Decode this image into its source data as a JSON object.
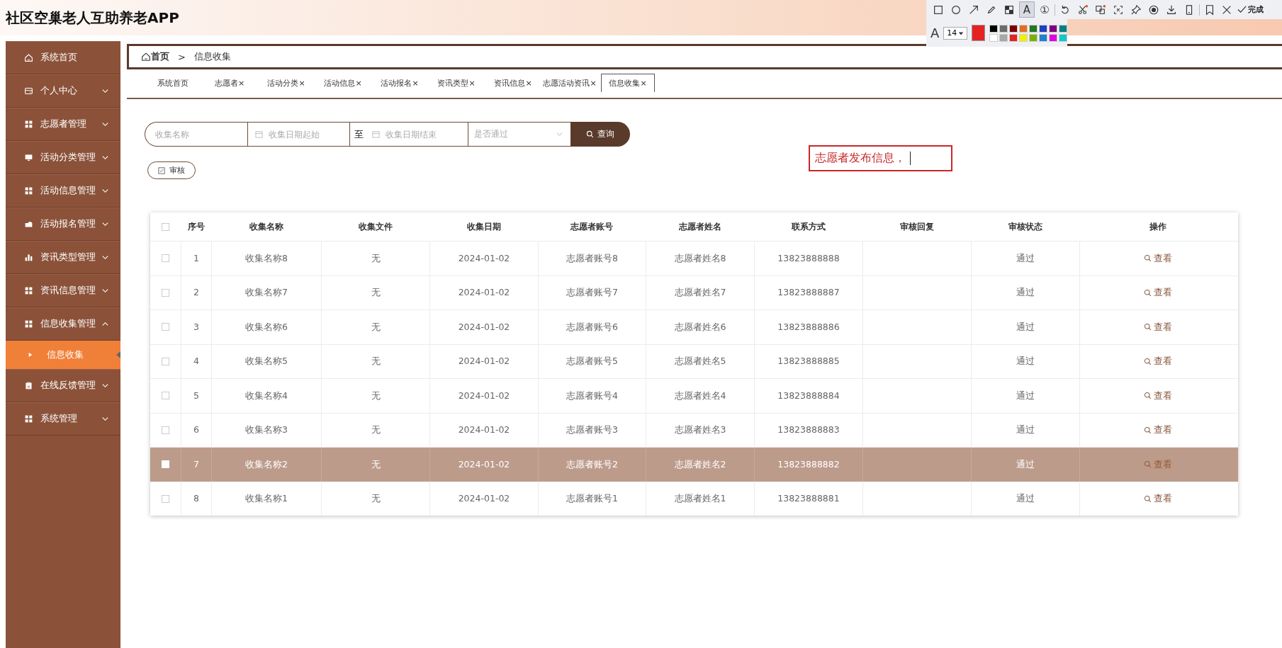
{
  "app_title": "社区空巢老人互助养老APP",
  "sidebar": {
    "items": [
      {
        "kind": "link",
        "label": "系统首页"
      },
      {
        "kind": "menu",
        "label": "个人中心",
        "expanded": false
      },
      {
        "kind": "menu",
        "label": "志愿者管理",
        "expanded": false
      },
      {
        "kind": "menu",
        "label": "活动分类管理",
        "expanded": false
      },
      {
        "kind": "menu",
        "label": "活动信息管理",
        "expanded": false
      },
      {
        "kind": "menu",
        "label": "活动报名管理",
        "expanded": false
      },
      {
        "kind": "menu",
        "label": "资讯类型管理",
        "expanded": false
      },
      {
        "kind": "menu",
        "label": "资讯信息管理",
        "expanded": false
      },
      {
        "kind": "menu",
        "label": "信息收集管理",
        "expanded": true,
        "children": [
          {
            "label": "信息收集",
            "selected": true
          }
        ]
      },
      {
        "kind": "menu",
        "label": "在线反馈管理",
        "expanded": false
      },
      {
        "kind": "menu",
        "label": "系统管理",
        "expanded": false
      }
    ]
  },
  "breadcrumb": {
    "home": "首页",
    "separator": ">",
    "current": "信息收集"
  },
  "tabs": [
    {
      "label": "系统首页",
      "selected": false
    },
    {
      "label": "志愿者×",
      "selected": false
    },
    {
      "label": "活动分类×",
      "selected": false
    },
    {
      "label": "活动信息×",
      "selected": false
    },
    {
      "label": "活动报名×",
      "selected": false
    },
    {
      "label": "资讯类型×",
      "selected": false
    },
    {
      "label": "资讯信息×",
      "selected": false
    },
    {
      "label": "志愿活动资讯×",
      "selected": false
    },
    {
      "label": "信息收集×",
      "selected": true
    }
  ],
  "search": {
    "name_placeholder": "收集名称",
    "start_placeholder": "收集日期起始",
    "to": "至",
    "end_placeholder": "收集日期结束",
    "status_placeholder": "是否通过",
    "button": "查询"
  },
  "review_button": "审核",
  "annotation": {
    "text": "志愿者发布信息，"
  },
  "table": {
    "columns": [
      "序号",
      "收集名称",
      "收集文件",
      "收集日期",
      "志愿者账号",
      "志愿者姓名",
      "联系方式",
      "审核回复",
      "审核状态",
      "操作"
    ],
    "all_checked": false,
    "rows": [
      {
        "cells": [
          "1",
          "收集名称8",
          "无",
          "2024-01-02",
          "志愿者账号8",
          "志愿者姓名8",
          "13823888888",
          "",
          "通过"
        ],
        "action": "查看",
        "checked": false,
        "selected": false
      },
      {
        "cells": [
          "2",
          "收集名称7",
          "无",
          "2024-01-02",
          "志愿者账号7",
          "志愿者姓名7",
          "13823888887",
          "",
          "通过"
        ],
        "action": "查看",
        "checked": false,
        "selected": false
      },
      {
        "cells": [
          "3",
          "收集名称6",
          "无",
          "2024-01-02",
          "志愿者账号6",
          "志愿者姓名6",
          "13823888886",
          "",
          "通过"
        ],
        "action": "查看",
        "checked": false,
        "selected": false
      },
      {
        "cells": [
          "4",
          "收集名称5",
          "无",
          "2024-01-02",
          "志愿者账号5",
          "志愿者姓名5",
          "13823888885",
          "",
          "通过"
        ],
        "action": "查看",
        "checked": false,
        "selected": false
      },
      {
        "cells": [
          "5",
          "收集名称4",
          "无",
          "2024-01-02",
          "志愿者账号4",
          "志愿者姓名4",
          "13823888884",
          "",
          "通过"
        ],
        "action": "查看",
        "checked": false,
        "selected": false
      },
      {
        "cells": [
          "6",
          "收集名称3",
          "无",
          "2024-01-02",
          "志愿者账号3",
          "志愿者姓名3",
          "13823888883",
          "",
          "通过"
        ],
        "action": "查看",
        "checked": false,
        "selected": false
      },
      {
        "cells": [
          "7",
          "收集名称2",
          "无",
          "2024-01-02",
          "志愿者账号2",
          "志愿者姓名2",
          "13823888882",
          "",
          "通过"
        ],
        "action": "查看",
        "checked": false,
        "selected": true
      },
      {
        "cells": [
          "8",
          "收集名称1",
          "无",
          "2024-01-02",
          "志愿者账号1",
          "志愿者姓名1",
          "13823888881",
          "",
          "通过"
        ],
        "action": "查看",
        "checked": false,
        "selected": false
      }
    ]
  },
  "capture_toolbar": {
    "tools": [
      {
        "selected": false
      },
      {
        "selected": false
      },
      {
        "selected": false
      },
      {
        "selected": false
      },
      {
        "selected": false
      },
      {
        "glyph": "A",
        "selected": true
      },
      {
        "glyph": "①",
        "selected": false
      },
      {
        "selected": false
      },
      {
        "selected": false
      },
      {
        "selected": false
      },
      {
        "selected": false
      },
      {
        "selected": false
      },
      {
        "selected": false
      },
      {
        "selected": false
      },
      {
        "selected": false
      },
      {
        "selected": false
      }
    ],
    "done": "完成",
    "font_glyph": "A",
    "font_size": "14",
    "current": {
      "color": "#e52222"
    },
    "palette": [
      {
        "color": "#000000"
      },
      {
        "color": "#6b6b6b"
      },
      {
        "color": "#7a0000"
      },
      {
        "color": "#e07020"
      },
      {
        "color": "#207820"
      },
      {
        "color": "#2040c0"
      },
      {
        "color": "#800080"
      },
      {
        "color": "#008080"
      },
      {
        "color": "#ffffff"
      },
      {
        "color": "#a8a8a8"
      },
      {
        "color": "#e52222"
      },
      {
        "color": "#f0f000"
      },
      {
        "color": "#7ab000"
      },
      {
        "color": "#2080d0"
      },
      {
        "color": "#e000e0"
      },
      {
        "color": "#10c8c8"
      }
    ]
  }
}
